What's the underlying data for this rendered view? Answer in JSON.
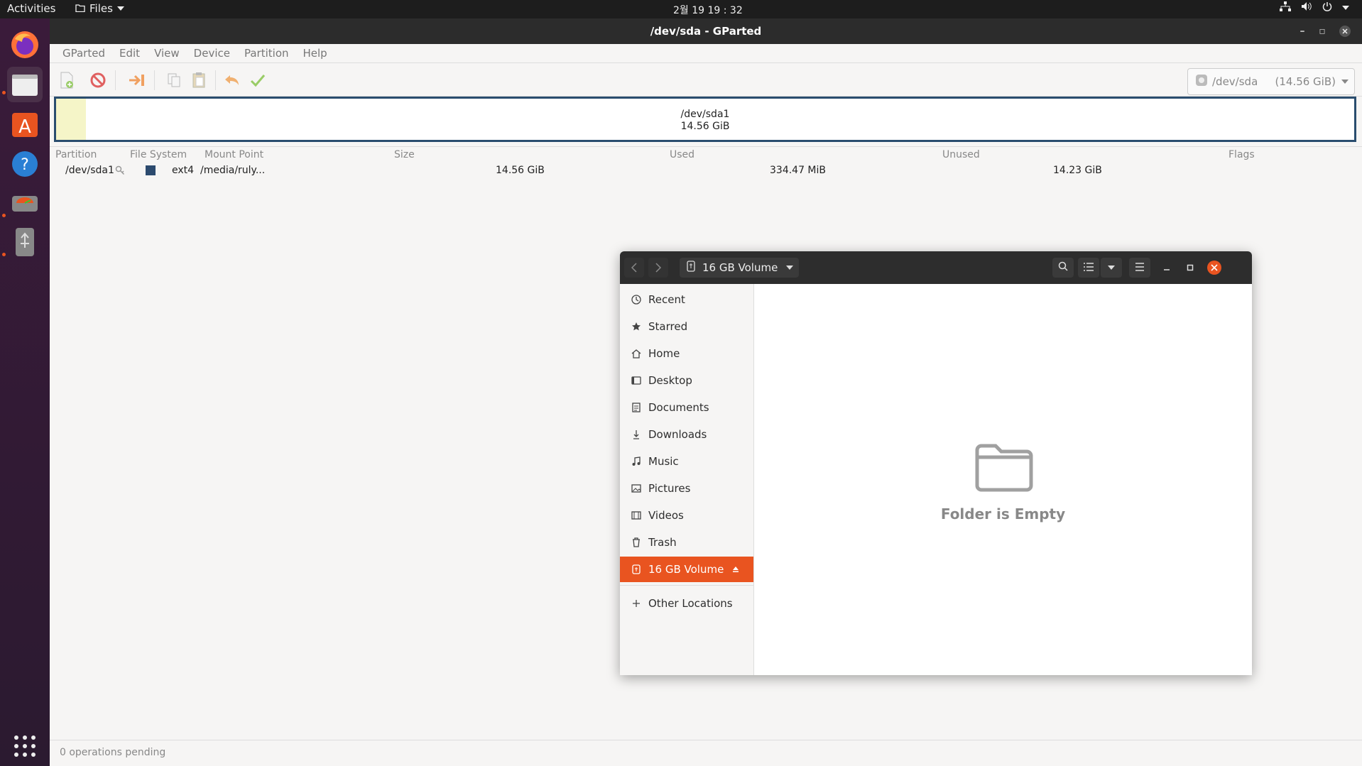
{
  "topbar": {
    "activities": "Activities",
    "app_menu": "Files",
    "clock": "2월 19  19 : 32"
  },
  "gparted": {
    "title": "/dev/sda - GParted",
    "menu": [
      "GParted",
      "Edit",
      "View",
      "Device",
      "Partition",
      "Help"
    ],
    "device": "/dev/sda",
    "device_size": "(14.56 GiB)",
    "diskmap": {
      "name": "/dev/sda1",
      "size": "14.56 GiB"
    },
    "columns": {
      "partition": "Partition",
      "filesystem": "File System",
      "mountpoint": "Mount Point",
      "size": "Size",
      "used": "Used",
      "unused": "Unused",
      "flags": "Flags"
    },
    "row": {
      "partition": "/dev/sda1",
      "filesystem": "ext4",
      "mountpoint": "/media/ruly...",
      "size": "14.56 GiB",
      "used": "334.47 MiB",
      "unused": "14.23 GiB",
      "flags": "",
      "fs_color": "#2c4a6e"
    },
    "status": "0 operations pending"
  },
  "nautilus": {
    "location": "16 GB Volume",
    "sidebar": {
      "recent": "Recent",
      "starred": "Starred",
      "home": "Home",
      "desktop": "Desktop",
      "documents": "Documents",
      "downloads": "Downloads",
      "music": "Music",
      "pictures": "Pictures",
      "videos": "Videos",
      "trash": "Trash",
      "volume": "16 GB Volume",
      "other": "Other Locations"
    },
    "empty_text": "Folder is Empty"
  },
  "colors": {
    "accent": "#e95420",
    "close_button": "#e95420"
  }
}
